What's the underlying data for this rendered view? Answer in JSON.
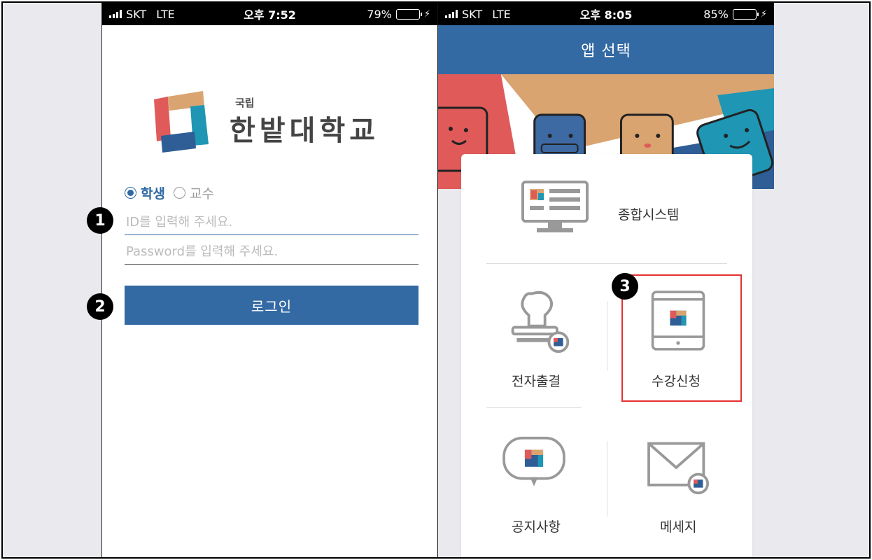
{
  "left_phone": {
    "status": {
      "carrier": "SKT",
      "network": "LTE",
      "time": "오후 7:52",
      "battery": "79%",
      "battery_level": 0.79
    },
    "logo": {
      "small": "국립",
      "big": "한밭대학교"
    },
    "user_type": {
      "student_label": "학생",
      "professor_label": "교수",
      "selected": "학생"
    },
    "id_field": {
      "placeholder": "ID를 입력해 주세요.",
      "value": ""
    },
    "password_field": {
      "placeholder": "Password를 입력해 주세요.",
      "value": ""
    },
    "login_label": "로그인"
  },
  "right_phone": {
    "status": {
      "carrier": "SKT",
      "network": "LTE",
      "time": "오후 8:05",
      "battery": "85%",
      "battery_level": 0.85
    },
    "title": "앱 선택",
    "menu": [
      {
        "label": "종합시스템",
        "icon": "monitor-icon"
      },
      {
        "label": "전자출결",
        "icon": "stamp-icon"
      },
      {
        "label": "수강신청",
        "icon": "tablet-icon"
      },
      {
        "label": "공지사항",
        "icon": "speech-bubble-icon"
      },
      {
        "label": "메세지",
        "icon": "envelope-icon"
      }
    ]
  },
  "annotations": {
    "badge1": "1",
    "badge2": "2",
    "badge3": "3"
  },
  "colors": {
    "primary": "#346aa3",
    "highlight": "#e53030",
    "logo_red": "#e05a5a",
    "logo_tan": "#d9a470",
    "logo_teal": "#1e96b4",
    "logo_blue": "#2f5d95"
  }
}
